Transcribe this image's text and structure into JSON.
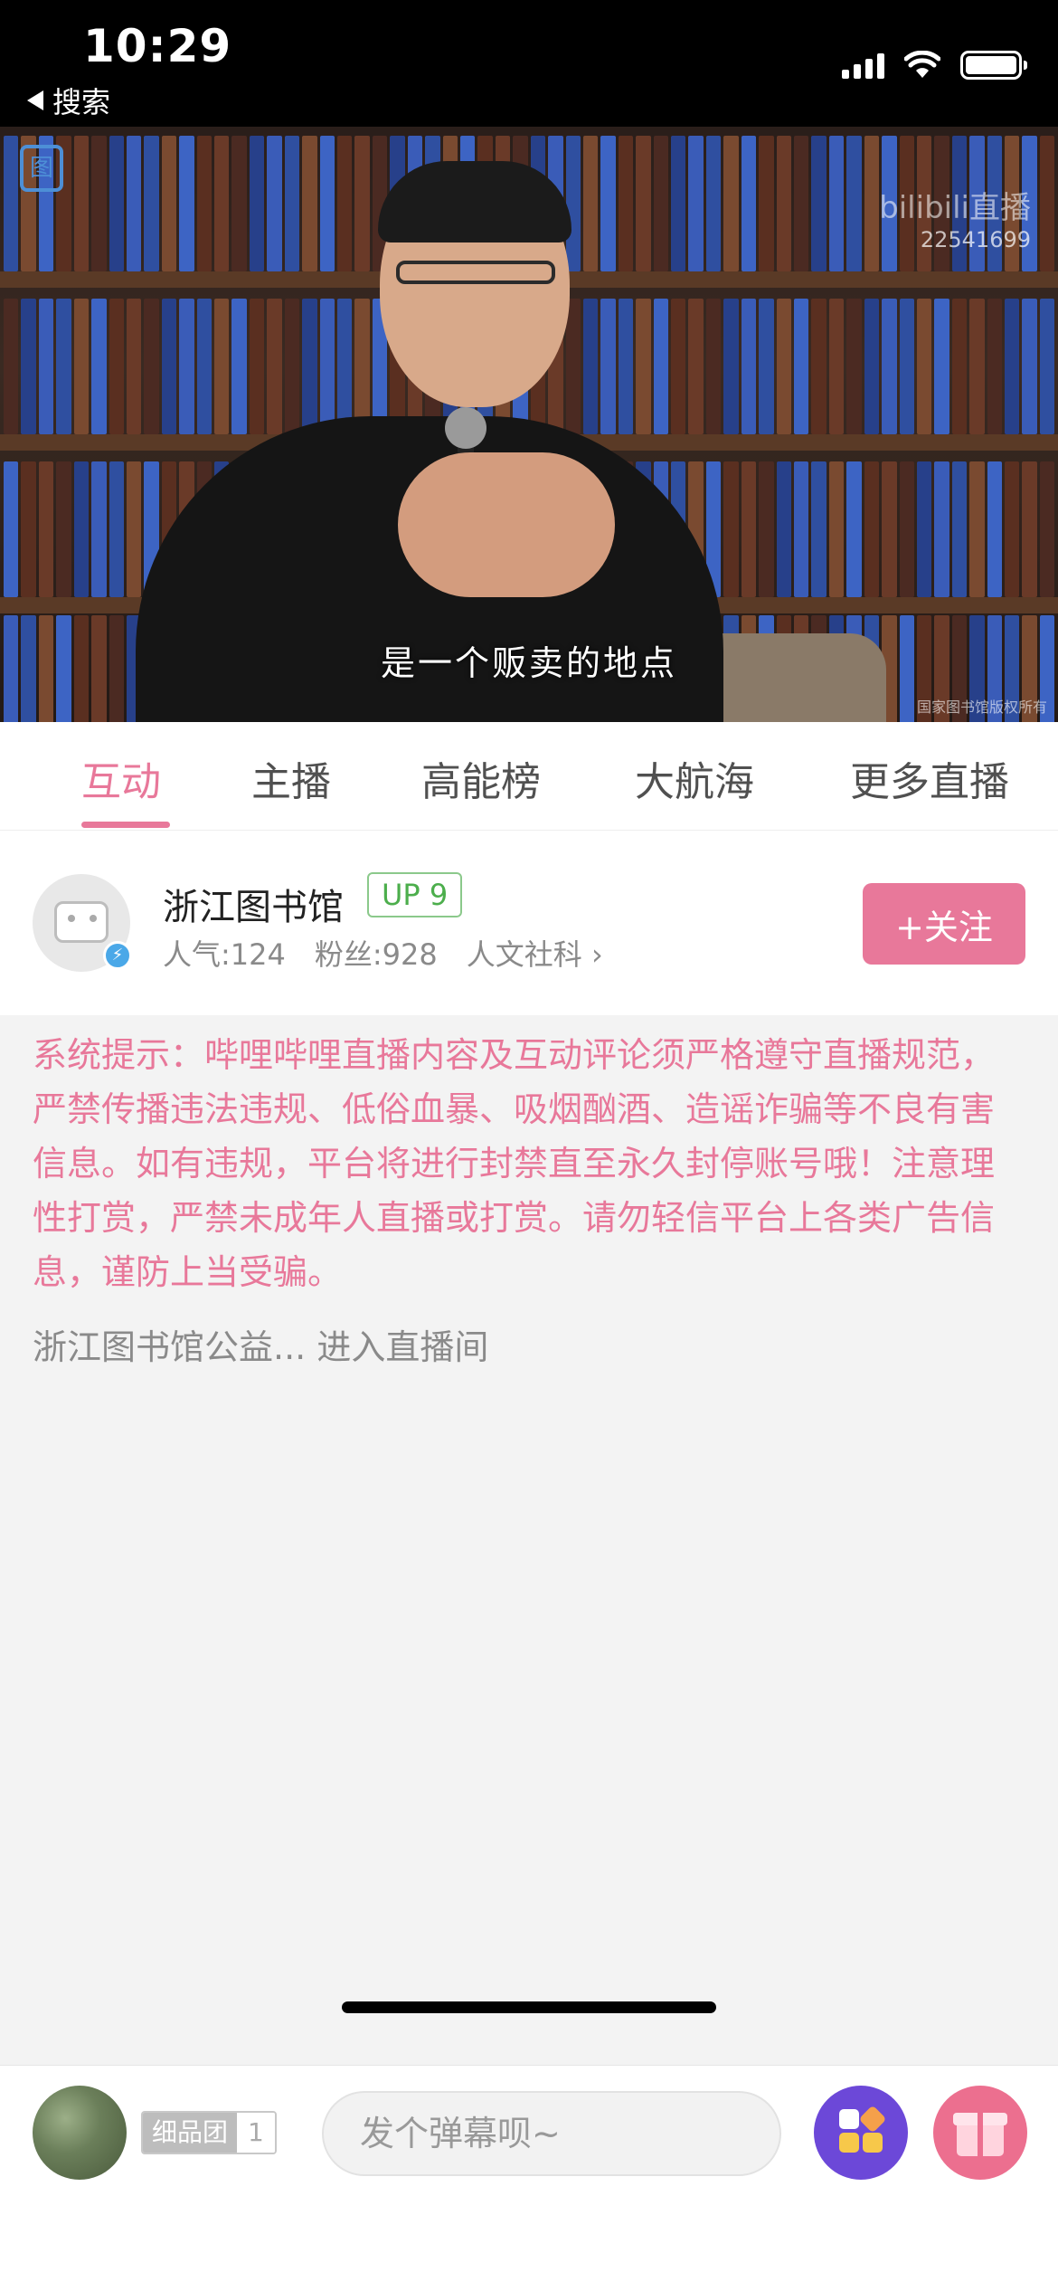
{
  "status_bar": {
    "time": "10:29",
    "back_label": "搜索"
  },
  "video": {
    "subtitle": "是一个贩卖的地点",
    "watermark_brand": "bilibili直播",
    "room_id": "22541699",
    "credit": "国家图书馆版权所有"
  },
  "tabs": [
    {
      "label": "互动",
      "active": true
    },
    {
      "label": "主播",
      "active": false
    },
    {
      "label": "高能榜",
      "active": false
    },
    {
      "label": "大航海",
      "active": false
    },
    {
      "label": "更多直播",
      "active": false
    }
  ],
  "streamer": {
    "name": "浙江图书馆",
    "level_badge": "UP 9",
    "popularity": "人气:124",
    "fans": "粉丝:928",
    "category": "人文社科",
    "follow_label": "+关注"
  },
  "chat": {
    "system_notice": "系统提示：哔哩哔哩直播内容及互动评论须严格遵守直播规范，严禁传播违法违规、低俗血暴、吸烟酗酒、造谣诈骗等不良有害信息。如有违规，平台将进行封禁直至永久封停账号哦！注意理性打赏，严禁未成年人直播或打赏。请勿轻信平台上各类广告信息，谨防上当受骗。",
    "enter_notice": "浙江图书馆公益... 进入直播间"
  },
  "bottom_bar": {
    "fan_badge_name": "细品团",
    "fan_badge_level": "1",
    "danmaku_placeholder": "发个弹幕呗~"
  },
  "colors": {
    "accent_pink": "#e8789a",
    "level_green": "#4cae4c",
    "fun_purple": "#6c48d8",
    "gift_pink": "#ec6f8f"
  }
}
